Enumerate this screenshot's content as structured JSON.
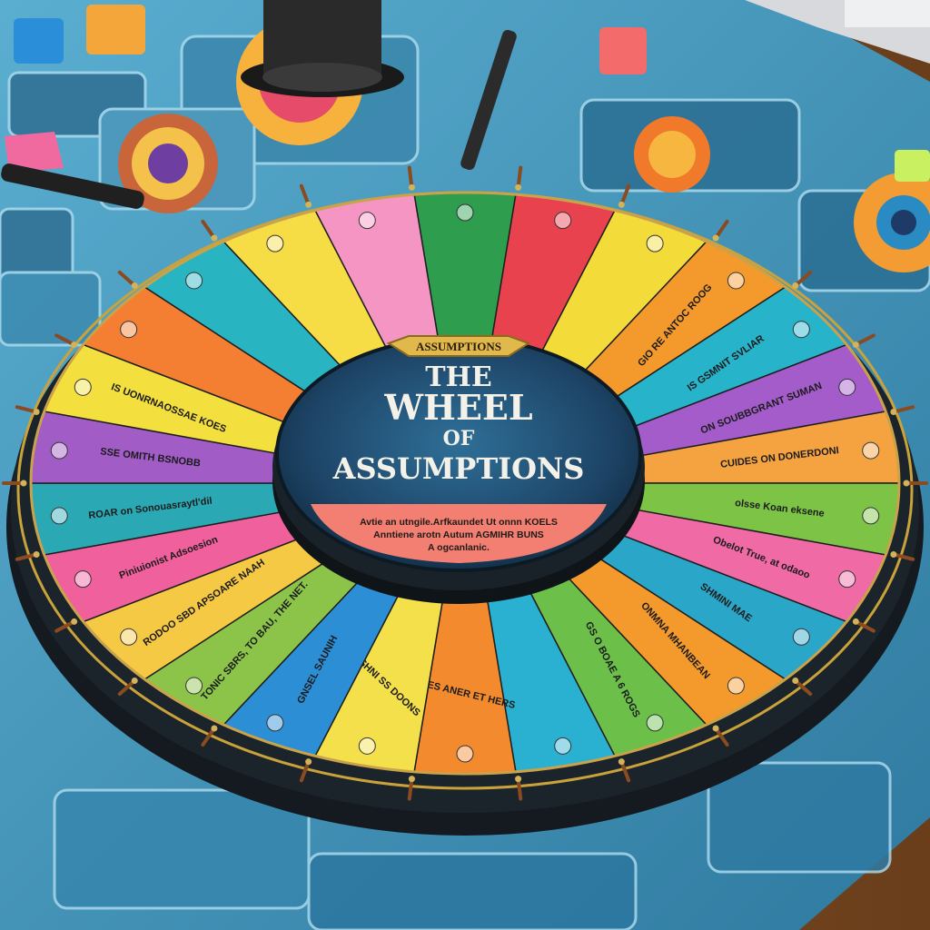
{
  "center": {
    "banner": "ASSUMPTIONS",
    "title_line1": "THE",
    "title_line2": "WHEEL",
    "title_line3": "OF",
    "title_line4": "ASSUMPTIONS",
    "subtext_line1": "Avtie an utngile.Arfkaundet Ut onnn KOELS",
    "subtext_line2": "Anntiene arotn Autum AGMIHR BUNS",
    "subtext_line3": "A ogcanlanic."
  },
  "segments": [
    {
      "label": "",
      "color": "#2e9d4e"
    },
    {
      "label": "",
      "color": "#e8424f"
    },
    {
      "label": "",
      "color": "#f3dc3a"
    },
    {
      "label": "GIO RE ANTOC ROOG",
      "color": "#f49a2c"
    },
    {
      "label": "IS GSMNIT SVLIAR",
      "color": "#27b3c9"
    },
    {
      "label": "ON SOUBBGRANT SUMAN",
      "color": "#a35cc9"
    },
    {
      "label": "CUIDES ON DONERDONI",
      "color": "#f5a340"
    },
    {
      "label": "olsse Koan eksene",
      "color": "#7cc346"
    },
    {
      "label": "Obelot True, at odaoo",
      "color": "#f06aa6"
    },
    {
      "label": "SHMINI MAE",
      "color": "#2aa6c8"
    },
    {
      "label": "ONMNA MHANBEAN",
      "color": "#f49a2c"
    },
    {
      "label": "GS O BOAE A 6 ROGS",
      "color": "#6cc04a"
    },
    {
      "label": "",
      "color": "#2ab0d0"
    },
    {
      "label": "JRES ANER ET HERS",
      "color": "#f38a2e"
    },
    {
      "label": "SHNI SS DOONS",
      "color": "#f3e04a"
    },
    {
      "label": "GNSEL SAUNIH",
      "color": "#2c8fd6"
    },
    {
      "label": "TONIC SBRS, TO BAU, THE NET.",
      "color": "#8cc44a"
    },
    {
      "label": "RODOO SBD APSOARE NAAH",
      "color": "#f6c945"
    },
    {
      "label": "Piniuionist Adsoesion",
      "color": "#f0609c"
    },
    {
      "label": "ROAR on Sonouasraytl'dil",
      "color": "#2aa9b5"
    },
    {
      "label": "SSE OMITH BSNOBB",
      "color": "#a15cc6"
    },
    {
      "label": "IS UONRNAOSSAE KOES",
      "color": "#f3df3e"
    },
    {
      "label": "",
      "color": "#f47f33"
    },
    {
      "label": "",
      "color": "#28b4c0"
    },
    {
      "label": "",
      "color": "#f6dc45"
    },
    {
      "label": "",
      "color": "#f595c3"
    }
  ],
  "colors": {
    "wood": "#7a4a22",
    "board": "#3d86a8",
    "board_light": "#6cbbd8",
    "rim": "#1b2126",
    "gold": "#c9a23b",
    "hub_blue": "#1f4e72"
  }
}
